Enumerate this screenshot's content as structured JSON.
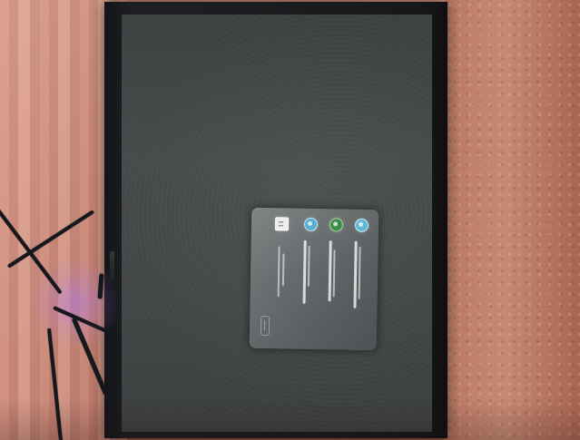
{
  "scene": {
    "image_type": "photo of monitor displaying rotated dialog",
    "colors": {
      "desk": "#d38d7a",
      "wall": "#b97860",
      "monitor_bezel": "#171819",
      "screen": "#444747",
      "dialog": "#666a6b",
      "blue_icon": "#5fb6d8",
      "green_icon": "#3c8d4b"
    }
  },
  "screen": {
    "menu_bar_text": "",
    "dialog": {
      "title": "",
      "body_text": "",
      "button_label": ""
    },
    "icons": [
      "blue-circle-app-icon",
      "green-blue-globe-icon",
      "blue-circle-icon",
      "white-document-icon"
    ]
  }
}
